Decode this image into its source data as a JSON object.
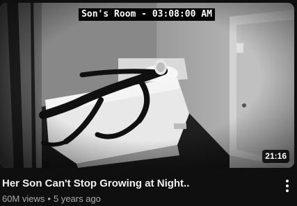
{
  "video": {
    "overlay_caption": "Son's Room - 03:08:00 AM",
    "duration": "21:16",
    "title": "Her Son Can't Stop Growing at Night..",
    "views": "60M views",
    "separator": "•",
    "age": "5 years ago"
  },
  "icons": {
    "more": "kebab-menu-icon"
  },
  "colors": {
    "background": "#0f0f0f",
    "title_text": "#f1f1f1",
    "meta_text": "#aaaaaa"
  }
}
